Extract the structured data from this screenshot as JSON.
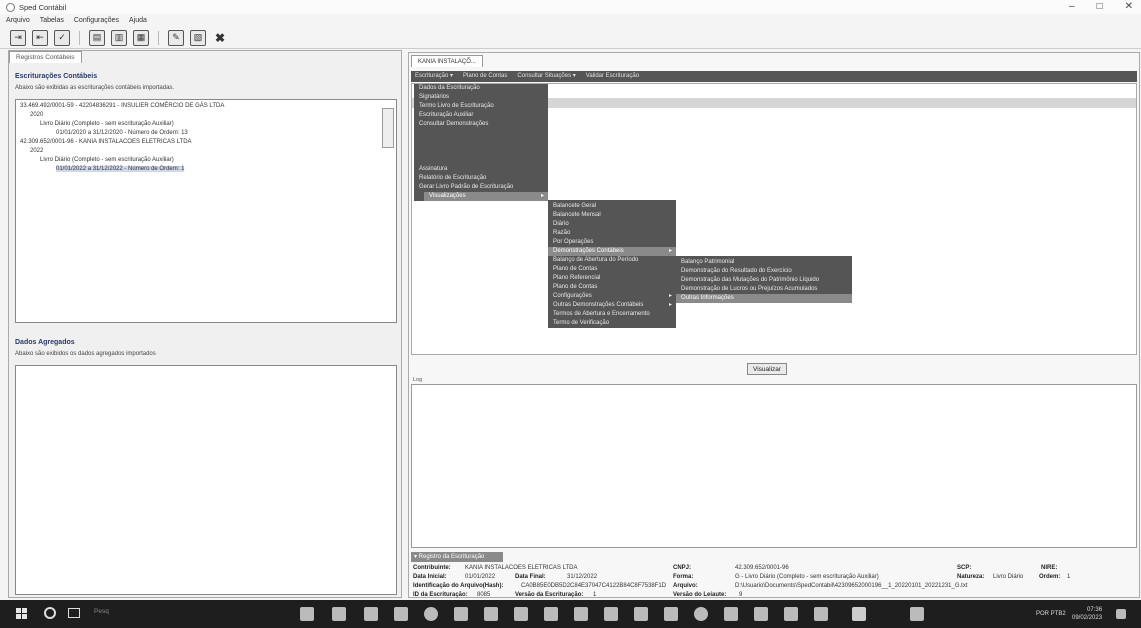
{
  "window": {
    "title": "Sped Contábil",
    "minimize": "–",
    "maximize": "□",
    "close": "✕"
  },
  "menubar": [
    "Arquivo",
    "Tabelas",
    "Configurações",
    "Ajuda"
  ],
  "toolbar_icons": [
    "import-icon",
    "export-icon",
    "validate-icon",
    "save-icon",
    "print-icon",
    "book-icon",
    "edit-icon",
    "report-icon",
    "close-icon"
  ],
  "left": {
    "tab": "Registros Contábeis",
    "section1_title": "Escriturações Contábeis",
    "section1_note": "Abaixo são exibidas as escriturações contábeis importadas.",
    "tree": [
      "33.469.492/0001-59 - 42204836291 - INSULIER COMÉRCIO DE GÁS LTDA",
      "2020",
      "Livro Diário (Completo - sem escrituração Auxiliar)",
      "01/01/2020 a 31/12/2020 - Número de Ordem: 13",
      "42.309.652/0001-96 - KANIA INSTALACOES ELETRICAS LTDA",
      "2022",
      "Livro Diário (Completo - sem escrituração Auxiliar)",
      "01/01/2022 a 31/12/2022 - Número de Ordem: 1"
    ],
    "section2_title": "Dados Agregados",
    "section2_note": "Abaixo são exibidos os dados agregados importados"
  },
  "right": {
    "doc_tab": "KANIA INSTALAÇÕ...",
    "nav": [
      "Escrituração ▾",
      "Plano de Contas",
      "Consultar Situações ▾",
      "Validar Escrituração"
    ],
    "visualize_button": "Visualizar",
    "log_label": "Log",
    "register_header": "▾ Registro da Escrituração",
    "register": {
      "contribuinte_lbl": "Contribuinte:",
      "contribuinte": "KANIA INSTALACOES ELETRICAS LTDA",
      "data_inicial_lbl": "Data Inicial:",
      "data_inicial": "01/01/2022",
      "data_final_lbl": "Data Final:",
      "data_final": "31/12/2022",
      "hash_lbl": "Identificação do Arquivo(Hash):",
      "hash": "CA0B85E0DB5D2C84E37047C4122B84C8F7538F1D",
      "id_escrit_lbl": "ID da Escrituração:",
      "id_escrit": "8085",
      "versao_escrit_lbl": "Versão da Escrituração:",
      "versao_escrit": "1",
      "cnpj_lbl": "CNPJ:",
      "cnpj": "42.309.652/0001-96",
      "forma_lbl": "Forma:",
      "forma": "G - Livro Diário (Completo - sem escrituração Auxiliar)",
      "arquivo_lbl": "Arquivo:",
      "arquivo": "D:\\Usuario\\Documents\\SpedContabil\\42309652000196__1_20220101_20221231_G.txt",
      "versao_leiaute_lbl": "Versão do Leiaute:",
      "versao_leiaute": "9",
      "scp_lbl": "SCP:",
      "nire_lbl": "NIRE:",
      "natureza_lbl": "Natureza:",
      "natureza": "Livro Diário",
      "ordem_lbl": "Ordem:",
      "ordem": "1"
    }
  },
  "menu1": [
    "Dados da Escrituração",
    "Signatários",
    "Termo Livro de Escrituração",
    "Escrituração Auxiliar",
    "Consultar Demonstrações",
    "",
    "Assinatura",
    "Relatório de Escrituração",
    "Gerar Livro Padrão de Escrituração",
    "Visualizações"
  ],
  "menu2": [
    "Balancete Geral",
    "Balancete Mensal",
    "Diário",
    "Razão",
    "Por Operações",
    "Demonstrações Contábeis",
    "Balanço de Abertura do Período",
    "Plano de Contas",
    "Plano Referencial",
    "Plano de Contas",
    "Configurações",
    "Outras Demonstrações Contábeis",
    "Termos de Abertura e Encerramento",
    "Termo de Verificação"
  ],
  "menu3": [
    "Balanço Patrimonial",
    "Demonstração do Resultado do Exercício",
    "Demonstração das Mutações do Patrimônio Líquido",
    "Demonstração de Lucros ou Prejuízos Acumulados",
    "Outras Informações"
  ],
  "taskbar": {
    "search_text": "Pesq",
    "clock": "07:36",
    "date": "09/02/2023",
    "lang": "POR PTB2"
  }
}
